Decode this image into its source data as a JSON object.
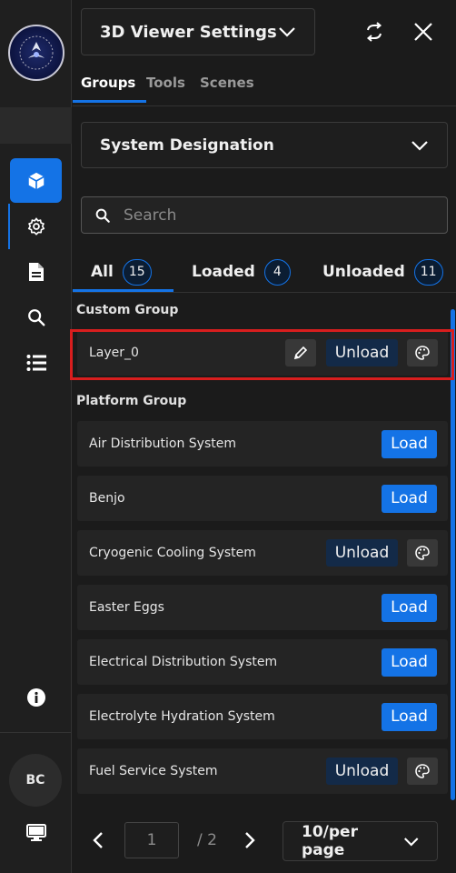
{
  "rail": {
    "logo_icon": "organization-seal-logo",
    "items": [
      {
        "icon": "cube-icon",
        "active": true
      },
      {
        "icon": "gear-icon",
        "active": false
      },
      {
        "icon": "document-icon",
        "active": false
      },
      {
        "icon": "search-icon",
        "active": false
      },
      {
        "icon": "list-icon",
        "active": false
      }
    ],
    "info_icon": "info-icon",
    "avatar_initials": "BC",
    "monitor_icon": "monitor-icon"
  },
  "header": {
    "title": "3D Viewer Settings",
    "refresh_icon": "refresh-icon",
    "close_icon": "close-icon"
  },
  "tabs": [
    {
      "label": "Groups",
      "active": true
    },
    {
      "label": "Tools",
      "active": false
    },
    {
      "label": "Scenes",
      "active": false
    }
  ],
  "system_select": {
    "value": "System Designation"
  },
  "search": {
    "placeholder": "Search",
    "value": ""
  },
  "filters": [
    {
      "label": "All",
      "count": "15",
      "active": true
    },
    {
      "label": "Loaded",
      "count": "4",
      "active": false
    },
    {
      "label": "Unloaded",
      "count": "11",
      "active": false
    }
  ],
  "groups": [
    {
      "title": "Custom Group",
      "items": [
        {
          "name": "Layer_0",
          "action": "Unload",
          "editable": true,
          "highlighted": true
        }
      ]
    },
    {
      "title": "Platform Group",
      "items": [
        {
          "name": "Air Distribution System",
          "action": "Load"
        },
        {
          "name": "Benjo",
          "action": "Load"
        },
        {
          "name": "Cryogenic Cooling System",
          "action": "Unload"
        },
        {
          "name": "Easter Eggs",
          "action": "Load"
        },
        {
          "name": "Electrical Distribution System",
          "action": "Load"
        },
        {
          "name": "Electrolyte Hydration System",
          "action": "Load"
        },
        {
          "name": "Fuel Service System",
          "action": "Unload"
        }
      ]
    }
  ],
  "pagination": {
    "current_page": "1",
    "total_pages": "/ 2",
    "per_page": "10/per page"
  },
  "colors": {
    "accent": "#1473e6",
    "highlight_border": "#d81e1e",
    "unload_bg": "#132a48"
  }
}
